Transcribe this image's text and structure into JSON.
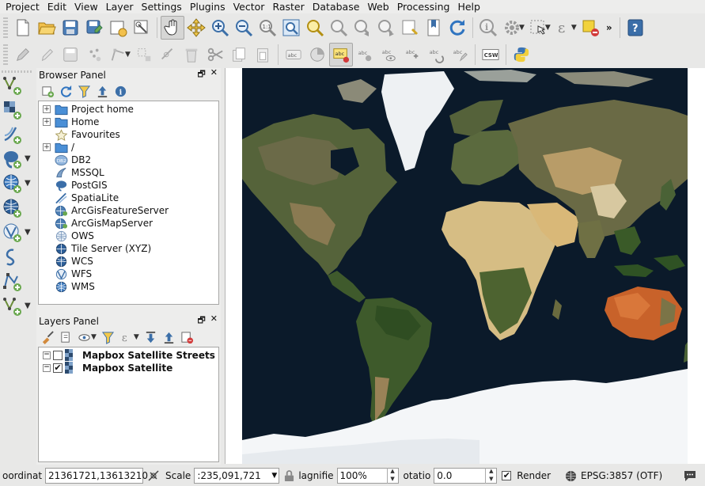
{
  "menubar": [
    "Project",
    "Edit",
    "View",
    "Layer",
    "Settings",
    "Plugins",
    "Vector",
    "Raster",
    "Database",
    "Web",
    "Processing",
    "Help"
  ],
  "toolbar1": {
    "icons": [
      "new-project-icon",
      "open-project-icon",
      "save-project-icon",
      "save-as-icon",
      "new-print-layout-icon",
      "layout-manager-icon",
      "pan-icon",
      "pan-to-selection-icon",
      "zoom-in-icon",
      "zoom-out-icon",
      "zoom-actual-icon",
      "zoom-full-icon",
      "zoom-to-selection-icon",
      "zoom-to-layer-icon",
      "zoom-last-icon",
      "zoom-next-icon",
      "new-map-view-icon",
      "new-bookmark-icon",
      "refresh-icon",
      "identify-icon",
      "action-icon",
      "select-icon",
      "expression-select-icon",
      "deselect-icon",
      "more-icon",
      "help-icon"
    ],
    "overflow_label": "»"
  },
  "toolbar2": {
    "label_buttons": [
      "abc",
      "abc",
      "abc",
      "abc",
      "abc",
      "abc",
      "abc"
    ],
    "csw_label": "CSW"
  },
  "left_toolbar": {
    "icons": [
      "add-vector-layer-icon",
      "add-raster-layer-icon",
      "add-delimited-text-icon",
      "add-postgis-layer-icon",
      "add-wms-layer-icon",
      "add-wfs-layer-icon",
      "add-virtual-layer-icon",
      "new-shapefile-icon",
      "add-gps-icon",
      "new-spatialite-icon"
    ]
  },
  "browser_panel": {
    "title": "Browser Panel",
    "items": [
      {
        "label": "Project home",
        "expandable": true,
        "icon": "folder-icon"
      },
      {
        "label": "Home",
        "expandable": true,
        "icon": "folder-icon"
      },
      {
        "label": "Favourites",
        "expandable": false,
        "icon": "star-icon"
      },
      {
        "label": "/",
        "expandable": true,
        "icon": "folder-icon"
      },
      {
        "label": "DB2",
        "expandable": false,
        "icon": "db2-icon"
      },
      {
        "label": "MSSQL",
        "expandable": false,
        "icon": "mssql-icon"
      },
      {
        "label": "PostGIS",
        "expandable": false,
        "icon": "postgis-icon"
      },
      {
        "label": "SpatiaLite",
        "expandable": false,
        "icon": "spatialite-icon"
      },
      {
        "label": "ArcGisFeatureServer",
        "expandable": false,
        "icon": "arcgis-feature-icon"
      },
      {
        "label": "ArcGisMapServer",
        "expandable": false,
        "icon": "arcgis-map-icon"
      },
      {
        "label": "OWS",
        "expandable": false,
        "icon": "ows-icon"
      },
      {
        "label": "Tile Server (XYZ)",
        "expandable": false,
        "icon": "xyz-icon"
      },
      {
        "label": "WCS",
        "expandable": false,
        "icon": "wcs-icon"
      },
      {
        "label": "WFS",
        "expandable": false,
        "icon": "wfs-icon"
      },
      {
        "label": "WMS",
        "expandable": false,
        "icon": "wms-icon"
      }
    ]
  },
  "layers_panel": {
    "title": "Layers Panel",
    "layers": [
      {
        "name": "Mapbox Satellite Streets",
        "checked": false
      },
      {
        "name": "Mapbox Satellite",
        "checked": true
      }
    ]
  },
  "statusbar": {
    "coordinate_label": "oordinat",
    "coordinate_value": "21361721,13613210",
    "scale_label": "Scale",
    "scale_value": ":235,091,721",
    "magnifier_label": "lagnifie",
    "magnifier_value": "100%",
    "rotation_label": "otatio",
    "rotation_value": "0.0",
    "render_label": "Render",
    "render_checked": true,
    "crs_label": "EPSG:3857 (OTF)"
  },
  "colors": {
    "ocean": "#0b1a2a",
    "ice": "#f4f6f8",
    "vegetation": "#3f5a2c",
    "desert": "#d9c188",
    "australia": "#c8622a"
  }
}
